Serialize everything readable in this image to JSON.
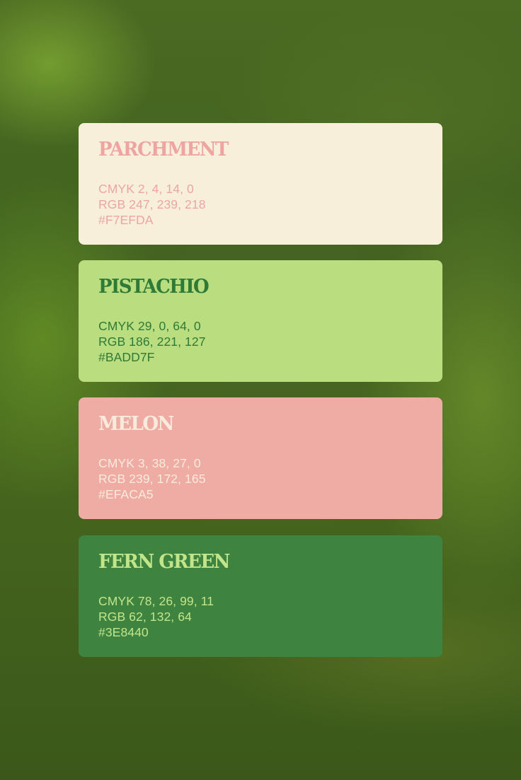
{
  "swatches": [
    {
      "name": "PARCHMENT",
      "cmyk": "CMYK 2, 4, 14, 0",
      "rgb": "RGB 247, 239, 218",
      "hex": "#F7EFDA",
      "background_color": "#F7EFDA",
      "text_color": "#EEA5A2"
    },
    {
      "name": "PISTACHIO",
      "cmyk": "CMYK 29, 0, 64, 0",
      "rgb": "RGB 186, 221, 127",
      "hex": "#BADD7F",
      "background_color": "#BADD7F",
      "text_color": "#2E7A36"
    },
    {
      "name": "MELON",
      "cmyk": "CMYK 3, 38, 27, 0",
      "rgb": "RGB 239, 172, 165",
      "hex": "#EFACA5",
      "background_color": "#EFACA5",
      "text_color": "#F8EBDC"
    },
    {
      "name": "FERN GREEN",
      "cmyk": "CMYK 78, 26, 99, 11",
      "rgb": "RGB 62, 132, 64",
      "hex": "#3E8440",
      "background_color": "#3E8440",
      "text_color": "#C3E58A"
    }
  ]
}
